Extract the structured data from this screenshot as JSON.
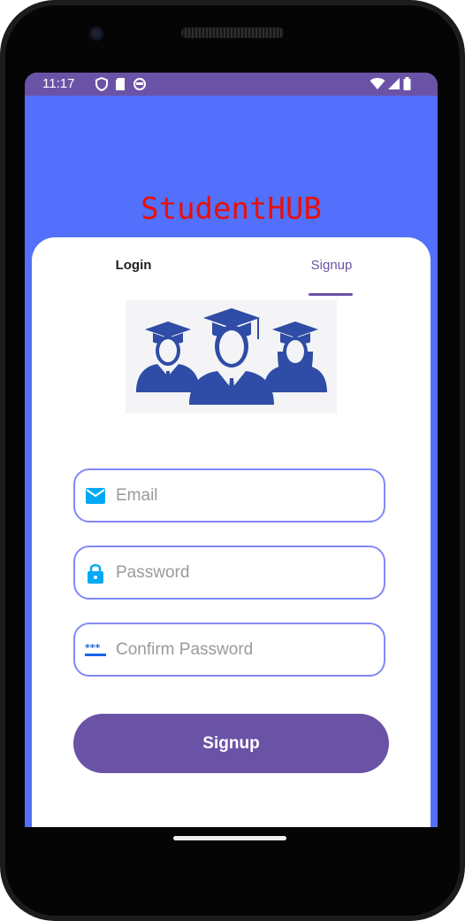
{
  "status_bar": {
    "time": "11:17",
    "icons": [
      "shield-icon",
      "sd-card-icon",
      "sync-icon"
    ],
    "right_icons": [
      "wifi-icon",
      "signal-icon",
      "battery-icon"
    ],
    "color": "#6a53a6"
  },
  "app": {
    "title": "StudentHUB",
    "title_color": "#e8100a",
    "background_color": "#5270fb"
  },
  "tabs": [
    {
      "label": "Login",
      "selected": false
    },
    {
      "label": "Signup",
      "selected": true
    }
  ],
  "illustration": {
    "icon": "graduates-icon",
    "color": "#2f4ca6"
  },
  "form": {
    "email": {
      "placeholder": "Email",
      "value": "",
      "icon": "email-icon"
    },
    "password": {
      "placeholder": "Password",
      "value": "",
      "icon": "lock-icon"
    },
    "confirm_password": {
      "placeholder": "Confirm Password",
      "value": "",
      "icon": "password-dots-icon"
    },
    "submit_label": "Signup",
    "accent_color": "#6a53a6",
    "field_border_color": "#8289f7"
  }
}
